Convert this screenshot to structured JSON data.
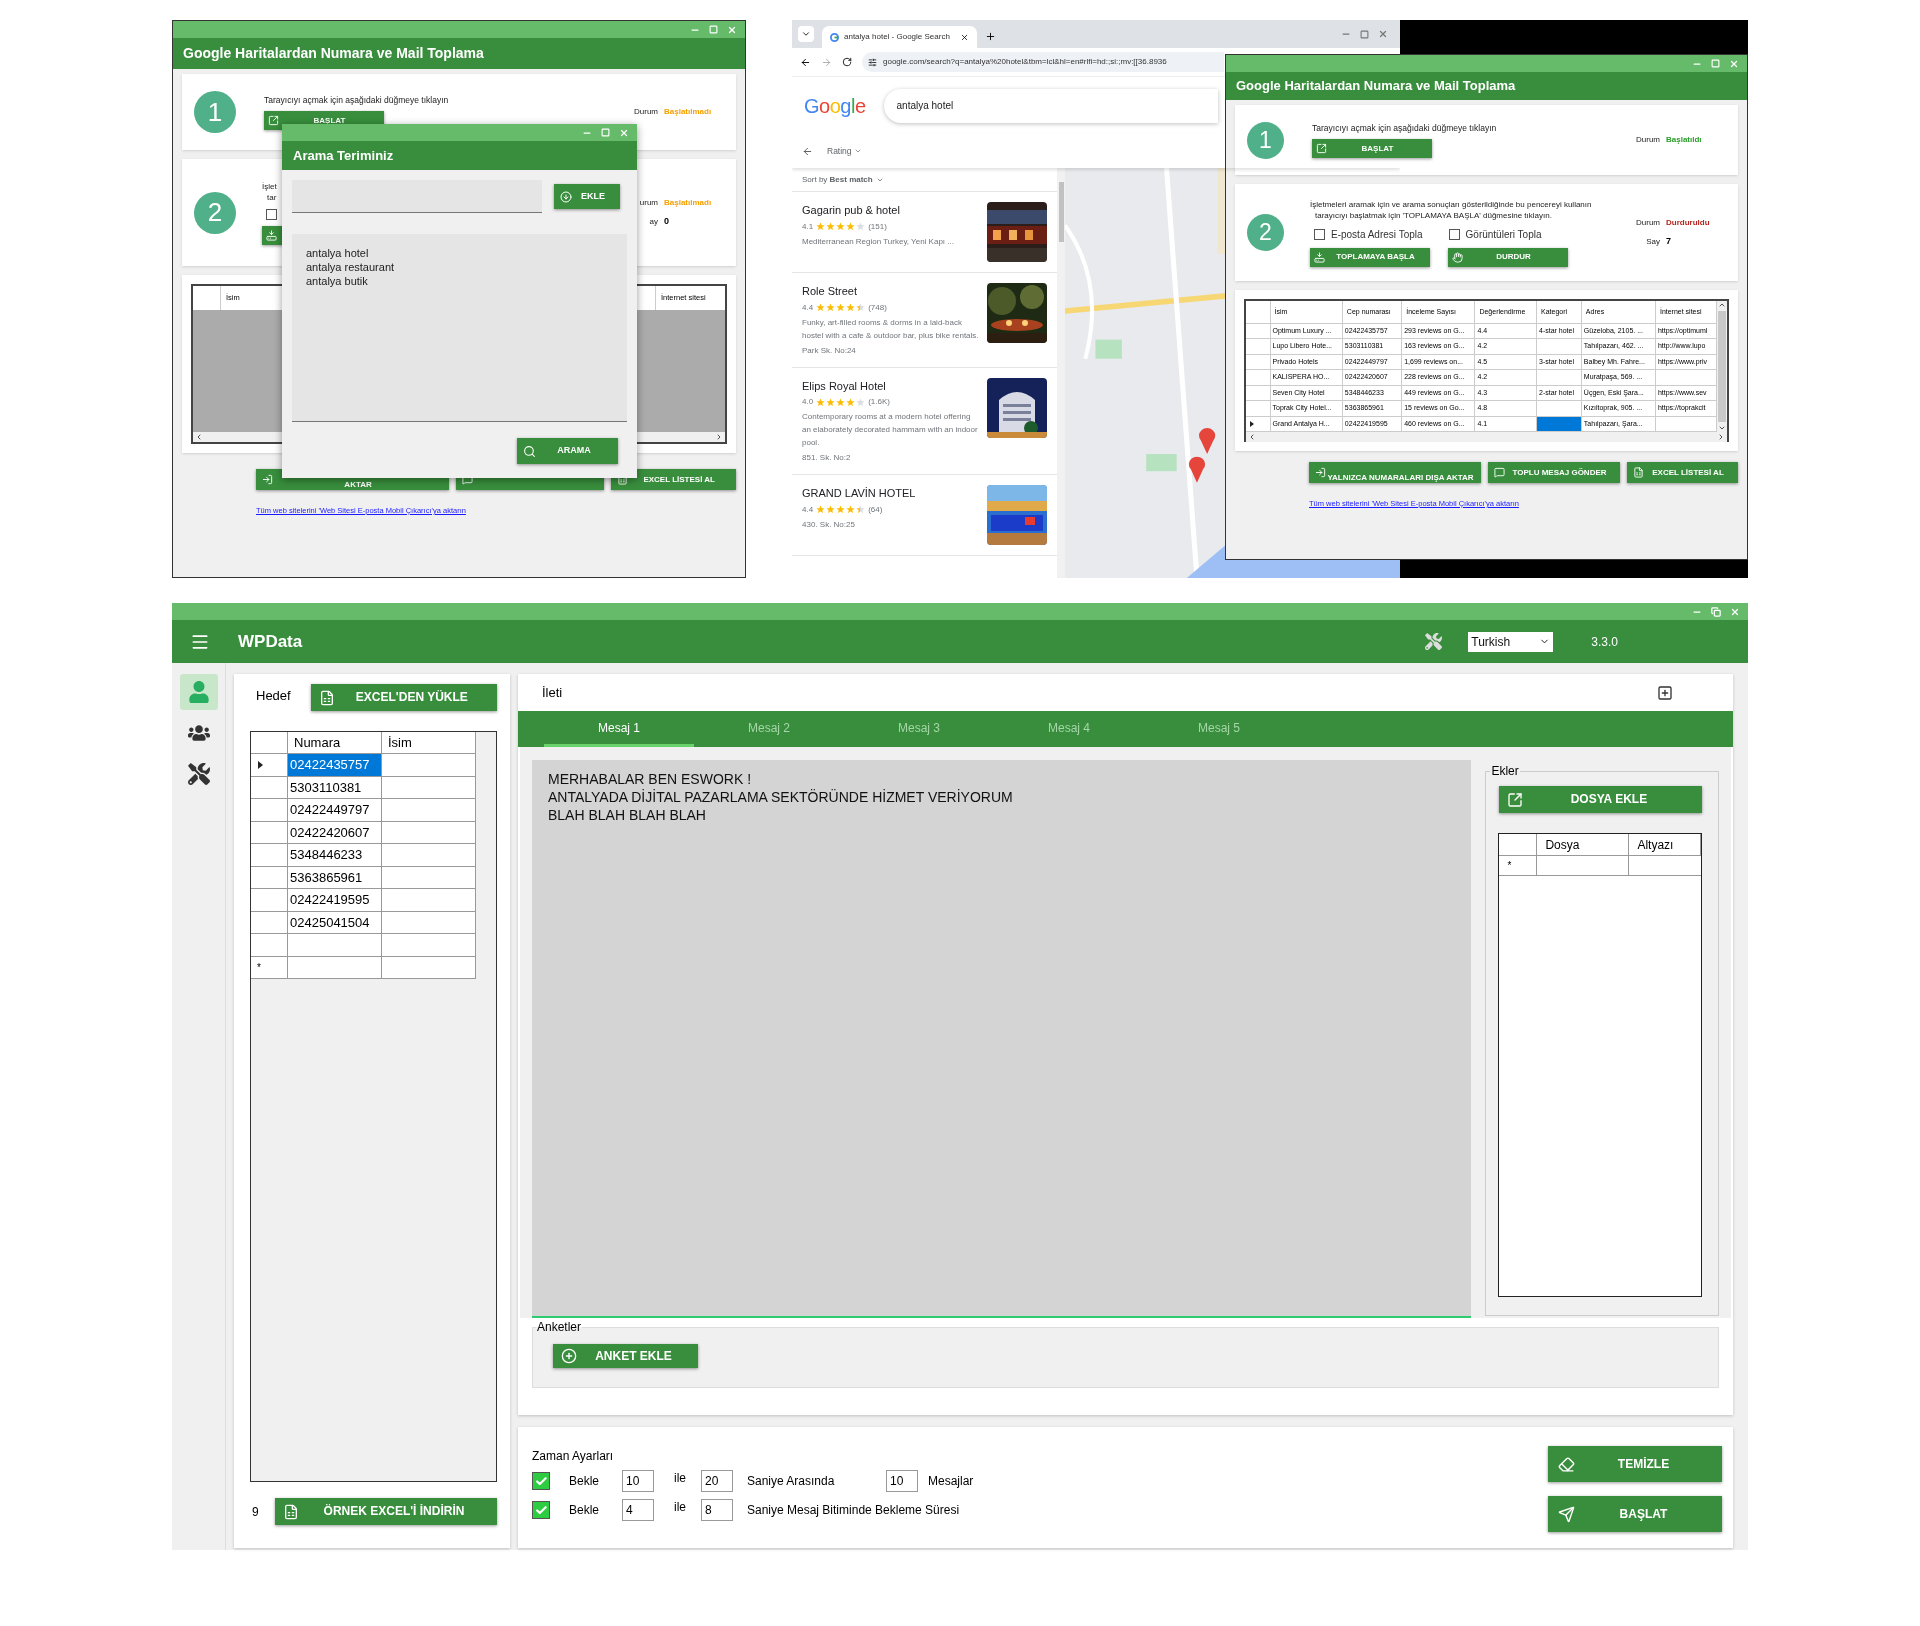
{
  "collector_window_1": {
    "title": "Google Haritalardan Numara ve Mail Toplama",
    "step1": {
      "number": "1",
      "instruction": "Tarayıcıyı açmak için aşağıdaki düğmeye tıklayın",
      "button": "BAŞLAT",
      "status_label": "Durum",
      "status": {
        "text": "Başlatılmadı",
        "color": "#f5a100"
      }
    },
    "step2": {
      "number": "2",
      "instruction_lines": [
        "İşlet",
        "tar"
      ],
      "checkboxes": [
        {
          "checked": false
        }
      ],
      "buttons": [
        {
          "kind": "start"
        }
      ],
      "status_label": "urum",
      "status": {
        "text": "Başlatılmadı",
        "color": "#f5a100"
      },
      "count_label": "ay",
      "count": "0"
    },
    "table": {
      "columns": [
        "İsim",
        "İnternet sitesi"
      ]
    },
    "buttons": [
      {
        "kind": "export",
        "label": "AKTAR"
      },
      {
        "kind": "message"
      },
      {
        "kind": "excel",
        "label": "EXCEL LİSTESİ AL"
      }
    ],
    "link": "Tüm web sitelerini 'Web Sitesi E-posta Mobil Çıkarıcı'ya aktarın"
  },
  "search_terms_dialog": {
    "title": "Arama Teriminiz",
    "add_button": "EKLE",
    "terms": [
      "antalya hotel",
      "antalya restaurant",
      "antalya butik"
    ],
    "search_button": "ARAMA"
  },
  "browser": {
    "tab_title": "antalya hotel - Google Search",
    "address": "google.com/search?q=antalya%20hotel&tbm=lcl&hl=en#rlfi=hd:;si:;mv:[[36.8936",
    "logo": "Google",
    "query": "antalya hotel",
    "filter": "Rating",
    "sort": "Sort by **Best match**",
    "results": [
      {
        "name": "Gagarin pub & hotel",
        "rating": "4.1",
        "stars": 4,
        "reviews": "(151)",
        "lines": [
          "Mediterranean Region Turkey, Yeni Kapı ..."
        ]
      },
      {
        "name": "Role Street",
        "rating": "4.4",
        "stars": 4.5,
        "reviews": "(748)",
        "lines": [
          "Funky, art-filled rooms & dorms in a laid-back hostel with a cafe & outdoor bar, plus bike rentals.",
          "Park Sk. No:24"
        ]
      },
      {
        "name": "Elips Royal Hotel",
        "rating": "4.0",
        "stars": 4,
        "reviews": "(1.6K)",
        "lines": [
          "Contemporary rooms at a modern hotel offering an elaborately decorated hammam with an indoor pool.",
          "851. Sk. No:2"
        ]
      },
      {
        "name": "GRAND LAVİN HOTEL",
        "rating": "4.4",
        "stars": 4.5,
        "reviews": "(64)",
        "lines": [
          "430. Sk. No:25"
        ]
      }
    ]
  },
  "collector_window_2": {
    "title": "Google Haritalardan Numara ve Mail Toplama",
    "step1": {
      "number": "1",
      "instruction": "Tarayıcıyı açmak için aşağıdaki düğmeye tıklayın",
      "button": "BAŞLAT",
      "status_label": "Durum",
      "status": {
        "text": "Başlatıldı",
        "color": "#2a9d2a"
      }
    },
    "step2": {
      "number": "2",
      "instruction_lines": [
        "İşletmeleri aramak için ve arama sonuçları gösterildiğinde bu pencereyi kullanın",
        "tarayıcıyı başlatmak için 'TOPLAMAYA BAŞLA' düğmesine tıklayın."
      ],
      "checkboxes": [
        {
          "label": "E-posta Adresi Topla",
          "checked": false
        },
        {
          "label": "Görüntüleri Topla",
          "checked": false
        }
      ],
      "buttons": [
        {
          "kind": "start",
          "label": "TOPLAMAYA BAŞLA"
        },
        {
          "kind": "stop",
          "label": "DURDUR"
        }
      ],
      "status_label": "Durum",
      "status": {
        "text": "Durduruldu",
        "color": "#b3261e"
      },
      "count_label": "Say",
      "count": "7"
    },
    "table": {
      "columns": [
        "İsim",
        "Cep numarası",
        "İnceleme Sayısı",
        "Değerlendirme",
        "Kategori",
        "Adres",
        "İnternet sitesi"
      ],
      "rows": [
        {
          "selected": false,
          "cells": [
            {
              "text": "Optimum Luxury ...",
              "selected": false
            },
            {
              "text": "02422435757",
              "selected": false
            },
            {
              "text": "293 reviews on G...",
              "selected": false
            },
            {
              "text": "4.4",
              "selected": false
            },
            {
              "text": "4-star hotel",
              "selected": false
            },
            {
              "text": "Güzeloba, 2105. ...",
              "selected": false
            },
            {
              "text": "https://optimuml",
              "selected": false
            }
          ]
        },
        {
          "selected": false,
          "cells": [
            {
              "text": "Lupo Libero Hote...",
              "selected": false
            },
            {
              "text": "5303110381",
              "selected": false
            },
            {
              "text": "163 reviews on G...",
              "selected": false
            },
            {
              "text": "4.2",
              "selected": false
            },
            {
              "selected": false
            },
            {
              "text": "Tahılpazarı, 462. ...",
              "selected": false
            },
            {
              "text": "http://www.lupo",
              "selected": false
            }
          ]
        },
        {
          "selected": false,
          "cells": [
            {
              "text": "Privado Hotels",
              "selected": false
            },
            {
              "text": "02422449797",
              "selected": false
            },
            {
              "text": "1,699 reviews on...",
              "selected": false
            },
            {
              "text": "4.5",
              "selected": false
            },
            {
              "text": "3-star hotel",
              "selected": false
            },
            {
              "text": "Balbey Mh. Fahre...",
              "selected": false
            },
            {
              "text": "https://www.priv",
              "selected": false
            }
          ]
        },
        {
          "selected": false,
          "cells": [
            {
              "text": "KALISPERA HO...",
              "selected": false
            },
            {
              "text": "02422420607",
              "selected": false
            },
            {
              "text": "228 reviews on G...",
              "selected": false
            },
            {
              "text": "4.2",
              "selected": false
            },
            {
              "selected": false
            },
            {
              "text": "Muratpaşa, 569. ...",
              "selected": false
            },
            {
              "selected": false
            }
          ]
        },
        {
          "selected": false,
          "cells": [
            {
              "text": "Seven City Hotel",
              "selected": false
            },
            {
              "text": "5348446233",
              "selected": false
            },
            {
              "text": "449 reviews on G...",
              "selected": false
            },
            {
              "text": "4.3",
              "selected": false
            },
            {
              "text": "2-star hotel",
              "selected": false
            },
            {
              "text": "Üçgen, Eski Şara...",
              "selected": false
            },
            {
              "text": "https://www.sev",
              "selected": false
            }
          ]
        },
        {
          "selected": false,
          "cells": [
            {
              "text": "Toprak City Hotel...",
              "selected": false
            },
            {
              "text": "5363865961",
              "selected": false
            },
            {
              "text": "15 reviews on Go...",
              "selected": false
            },
            {
              "text": "4.8",
              "selected": false
            },
            {
              "selected": false
            },
            {
              "text": "Kızıltoprak, 905. ...",
              "selected": false
            },
            {
              "text": "https://toprakcit",
              "selected": false
            }
          ]
        },
        {
          "selected": true,
          "cells": [
            {
              "text": "Grand Antalya H...",
              "selected": false
            },
            {
              "text": "02422419595",
              "selected": false
            },
            {
              "text": "460 reviews on G...",
              "selected": false
            },
            {
              "text": "4.1",
              "selected": false
            },
            {
              "selected": true
            },
            {
              "text": "Tahılpazarı, Şara...",
              "selected": false
            },
            {
              "selected": false
            }
          ]
        }
      ]
    },
    "buttons": [
      {
        "kind": "export",
        "label": "YALNIZCA NUMARALARI DIŞA AKTAR"
      },
      {
        "kind": "message",
        "label": "TOPLU MESAJ GÖNDER"
      },
      {
        "kind": "excel",
        "label": "EXCEL LİSTESİ AL"
      }
    ],
    "link": "Tüm web sitelerini 'Web Sitesi E-posta Mobil Çıkarıcı'ya aktarın"
  },
  "wpdata": {
    "app_name": "WPData",
    "language": "Turkish",
    "version": "3.3.0",
    "nav": [
      {
        "kind": "user",
        "selected": true
      },
      {
        "kind": "group",
        "selected": false
      },
      {
        "kind": "tools",
        "selected": false
      }
    ],
    "target": {
      "label": "Hedef",
      "load_button": "EXCEL'DEN YÜKLE",
      "columns": [
        "Numara",
        "İsim"
      ],
      "rows": [
        {
          "number": "02422435757",
          "selected": true
        },
        {
          "number": "5303110381",
          "selected": false
        },
        {
          "number": "02422449797",
          "selected": false
        },
        {
          "number": "02422420607",
          "selected": false
        },
        {
          "number": "5348446233",
          "selected": false
        },
        {
          "number": "5363865961",
          "selected": false
        },
        {
          "number": "02422419595",
          "selected": false
        },
        {
          "number": "02425041504",
          "selected": false
        }
      ],
      "new_row_marker": "*",
      "count": "9",
      "sample_button": "ÖRNEK EXCEL'İ İNDİRİN"
    },
    "message": {
      "label": "İleti",
      "tabs": [
        {
          "label": "Mesaj 1",
          "selected": true
        },
        {
          "label": "Mesaj 2",
          "selected": false
        },
        {
          "label": "Mesaj 3",
          "selected": false
        },
        {
          "label": "Mesaj 4",
          "selected": false
        },
        {
          "label": "Mesaj 5",
          "selected": false
        }
      ],
      "text_lines": [
        "MERHABALAR BEN ESWORK !",
        "ANTALYADA DİJİTAL PAZARLAMA SEKTÖRÜNDE HİZMET VERİYORUM",
        "BLAH BLAH BLAH BLAH"
      ],
      "attachments": {
        "label": "Ekler",
        "button": "DOSYA EKLE",
        "columns": [
          "Dosya",
          "Altyazı"
        ],
        "new_row_marker": "*"
      },
      "polls": {
        "label": "Anketler",
        "button": "ANKET EKLE"
      }
    },
    "timing": {
      "label": "Zaman Ayarları",
      "rows": [
        {
          "checked": true,
          "wait_label": "Bekle",
          "from": "10",
          "between": "ile",
          "to": "20",
          "unit": "Saniye Arasında",
          "count": "10",
          "count_label": "Mesajlar"
        },
        {
          "checked": true,
          "wait_label": "Bekle",
          "from": "4",
          "between": "ile",
          "to": "8",
          "unit": "Saniye Mesaj Bitiminde Bekleme Süresi"
        }
      ],
      "clear_button": "TEMİZLE",
      "start_button": "BAŞLAT"
    }
  }
}
